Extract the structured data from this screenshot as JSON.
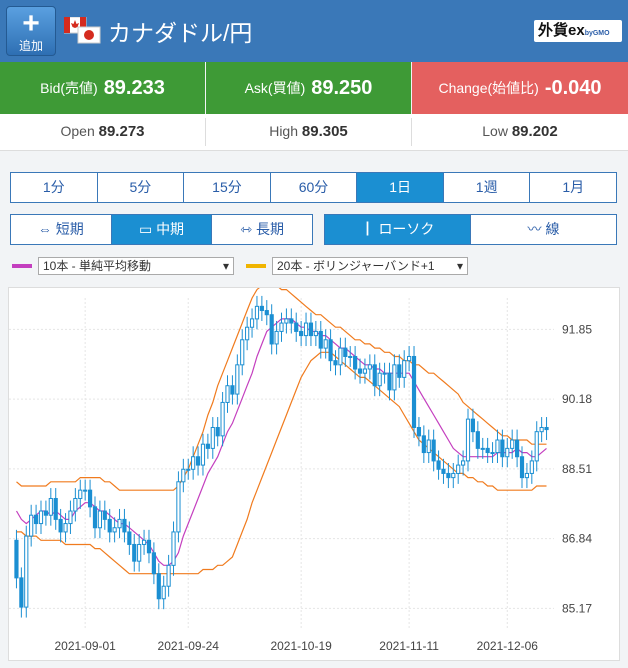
{
  "header": {
    "add_label": "追加",
    "pair_name": "カナダドル/円",
    "logo_text": "外貨ex",
    "logo_sub": "byGMO"
  },
  "quote": {
    "bid_label": "Bid(売値)",
    "bid_value": "89.233",
    "ask_label": "Ask(買値)",
    "ask_value": "89.250",
    "change_label": "Change(始値比)",
    "change_value": "-0.040"
  },
  "stats": {
    "open_label": "Open",
    "open_value": "89.273",
    "high_label": "High",
    "high_value": "89.305",
    "low_label": "Low",
    "low_value": "89.202"
  },
  "timeframes": [
    "1分",
    "5分",
    "15分",
    "60分",
    "1日",
    "1週",
    "1月"
  ],
  "timeframe_selected": "1日",
  "periods": [
    "短期",
    "中期",
    "長期"
  ],
  "period_selected": "中期",
  "chart_types": [
    "ローソク",
    "線"
  ],
  "chart_type_selected": "ローソク",
  "indicators": {
    "ma_label": "10本 - 単純平均移動",
    "bb_label": "20本 - ボリンジャーバンド+1"
  },
  "colors": {
    "header_bg": "#3a78b8",
    "bid_bg": "#3e9a36",
    "change_bg": "#e4605f",
    "candle_up": "#1b8fd2",
    "ma_line": "#c43fbf",
    "bb_line": "#f07b1e",
    "selected_bg": "#1b8fd2"
  },
  "chart_data": {
    "type": "candlestick",
    "y_ticks": [
      "91.85",
      "90.18",
      "88.51",
      "86.84",
      "85.17"
    ],
    "ylim": [
      84.7,
      92.6
    ],
    "x_ticks": [
      "2021-09-01",
      "2021-09-24",
      "2021-10-19",
      "2021-11-11",
      "2021-12-06"
    ],
    "close": [
      85.9,
      85.2,
      86.9,
      87.4,
      87.2,
      87.5,
      87.4,
      87.8,
      87.3,
      87.0,
      87.2,
      87.5,
      87.8,
      88.0,
      88.0,
      87.6,
      87.1,
      87.5,
      87.3,
      87.0,
      87.1,
      87.3,
      87.0,
      86.7,
      86.3,
      86.7,
      86.8,
      86.5,
      86.0,
      85.4,
      85.7,
      86.2,
      87.0,
      88.2,
      88.5,
      88.5,
      88.8,
      88.6,
      89.1,
      89.0,
      89.5,
      89.3,
      90.1,
      90.5,
      90.3,
      91.0,
      91.6,
      91.9,
      92.1,
      92.4,
      92.3,
      92.2,
      91.5,
      91.8,
      92.0,
      92.1,
      92.0,
      91.8,
      91.7,
      92.0,
      91.7,
      91.8,
      91.4,
      91.6,
      91.1,
      91.0,
      91.4,
      91.2,
      91.2,
      90.9,
      90.8,
      90.9,
      91.0,
      90.5,
      90.8,
      90.8,
      90.4,
      91.0,
      90.7,
      91.1,
      91.2,
      89.5,
      89.3,
      88.9,
      89.2,
      88.7,
      88.5,
      88.4,
      88.3,
      88.4,
      88.6,
      88.7,
      89.7,
      89.4,
      89.0,
      89.0,
      88.9,
      88.9,
      89.2,
      88.8,
      89.0,
      89.2,
      88.8,
      88.3,
      88.4,
      88.7,
      89.4,
      89.5,
      89.45
    ],
    "open": [
      86.8,
      85.9,
      85.2,
      86.9,
      87.4,
      87.2,
      87.5,
      87.4,
      87.8,
      87.3,
      87.0,
      87.2,
      87.5,
      87.8,
      88.0,
      88.0,
      87.6,
      87.1,
      87.5,
      87.3,
      87.0,
      87.1,
      87.3,
      87.0,
      86.7,
      86.3,
      86.7,
      86.8,
      86.5,
      86.0,
      85.4,
      85.7,
      86.2,
      87.0,
      88.2,
      88.5,
      88.5,
      88.8,
      88.6,
      89.1,
      89.0,
      89.5,
      89.3,
      90.1,
      90.5,
      90.3,
      91.0,
      91.6,
      91.9,
      92.1,
      92.4,
      92.3,
      92.2,
      91.5,
      91.8,
      92.0,
      92.1,
      92.0,
      91.8,
      91.7,
      92.0,
      91.7,
      91.8,
      91.4,
      91.6,
      91.1,
      91.0,
      91.4,
      91.2,
      91.2,
      90.9,
      90.8,
      90.9,
      91.0,
      90.5,
      90.8,
      90.8,
      90.4,
      91.0,
      90.7,
      91.1,
      91.2,
      89.5,
      89.3,
      88.9,
      89.2,
      88.7,
      88.5,
      88.4,
      88.3,
      88.4,
      88.6,
      88.7,
      89.7,
      89.4,
      89.0,
      89.0,
      88.9,
      88.9,
      89.2,
      88.8,
      89.0,
      89.2,
      88.8,
      88.3,
      88.4,
      88.7,
      89.4,
      89.5
    ],
    "ma10": [
      87.5,
      87.3,
      87.2,
      87.3,
      87.4,
      87.5,
      87.5,
      87.4,
      87.5,
      87.4,
      87.3,
      87.3,
      87.5,
      87.6,
      87.7,
      87.7,
      87.6,
      87.5,
      87.5,
      87.4,
      87.3,
      87.2,
      87.2,
      87.1,
      87.0,
      86.9,
      86.8,
      86.7,
      86.5,
      86.3,
      86.2,
      86.2,
      86.3,
      86.5,
      86.9,
      87.2,
      87.5,
      87.8,
      88.1,
      88.4,
      88.6,
      88.8,
      89.1,
      89.4,
      89.6,
      89.9,
      90.2,
      90.5,
      90.8,
      91.2,
      91.5,
      91.8,
      91.9,
      92.0,
      92.1,
      92.1,
      92.1,
      92.0,
      91.9,
      91.9,
      91.8,
      91.8,
      91.7,
      91.7,
      91.6,
      91.5,
      91.4,
      91.4,
      91.3,
      91.2,
      91.1,
      91.0,
      91.0,
      90.9,
      90.9,
      90.8,
      90.8,
      90.8,
      90.8,
      90.8,
      90.8,
      90.6,
      90.4,
      90.2,
      90.0,
      89.8,
      89.6,
      89.4,
      89.2,
      89.0,
      88.9,
      88.8,
      88.8,
      88.8,
      88.8,
      88.8,
      88.8,
      88.8,
      88.9,
      88.9,
      88.9,
      88.9,
      89.0,
      88.9,
      88.9,
      88.8,
      88.8,
      88.9,
      89.0
    ],
    "bb_upper": [
      88.2,
      88.1,
      88.1,
      88.1,
      88.1,
      88.1,
      88.1,
      88.2,
      88.2,
      88.2,
      88.2,
      88.2,
      88.2,
      88.3,
      88.3,
      88.3,
      88.3,
      88.3,
      88.2,
      88.2,
      88.1,
      88.0,
      88.0,
      88.0,
      88.0,
      88.0,
      88.0,
      88.0,
      88.0,
      88.0,
      88.0,
      88.0,
      88.0,
      88.1,
      88.3,
      88.5,
      88.8,
      89.1,
      89.4,
      89.8,
      90.1,
      90.5,
      90.8,
      91.1,
      91.4,
      91.7,
      92.0,
      92.3,
      92.6,
      92.8,
      92.9,
      93.0,
      93.0,
      92.9,
      92.8,
      92.8,
      92.7,
      92.6,
      92.5,
      92.4,
      92.3,
      92.2,
      92.2,
      92.1,
      92.0,
      91.9,
      91.9,
      91.8,
      91.7,
      91.6,
      91.6,
      91.5,
      91.5,
      91.4,
      91.4,
      91.3,
      91.3,
      91.2,
      91.2,
      91.1,
      91.1,
      91.0,
      91.0,
      90.9,
      90.8,
      90.8,
      90.7,
      90.6,
      90.5,
      90.4,
      90.3,
      90.1,
      90.0,
      89.9,
      89.8,
      89.7,
      89.6,
      89.5,
      89.4,
      89.3,
      89.3,
      89.2,
      89.2,
      89.2,
      89.2,
      89.1,
      89.1,
      89.1,
      89.1
    ],
    "bb_lower": [
      87.0,
      87.0,
      86.9,
      86.9,
      86.9,
      86.8,
      86.8,
      86.8,
      86.8,
      86.8,
      86.7,
      86.7,
      86.7,
      86.7,
      86.7,
      86.7,
      86.6,
      86.6,
      86.5,
      86.4,
      86.3,
      86.2,
      86.1,
      86.0,
      86.0,
      86.0,
      86.0,
      86.0,
      86.0,
      86.0,
      86.0,
      86.0,
      86.0,
      86.0,
      86.0,
      86.0,
      86.0,
      86.0,
      86.1,
      86.1,
      86.1,
      86.2,
      86.2,
      86.3,
      86.4,
      86.7,
      87.0,
      87.3,
      87.7,
      88.0,
      88.3,
      88.6,
      88.9,
      89.2,
      89.5,
      89.8,
      90.1,
      90.4,
      90.7,
      90.9,
      91.1,
      91.2,
      91.3,
      91.3,
      91.3,
      91.2,
      91.1,
      91.0,
      90.9,
      90.8,
      90.7,
      90.7,
      90.6,
      90.5,
      90.4,
      90.3,
      90.2,
      90.1,
      90.0,
      89.8,
      89.6,
      89.4,
      89.2,
      89.1,
      89.0,
      88.9,
      88.8,
      88.7,
      88.6,
      88.5,
      88.4,
      88.4,
      88.3,
      88.3,
      88.2,
      88.2,
      88.1,
      88.1,
      88.0,
      88.0,
      88.0,
      88.0,
      88.0,
      88.0,
      88.0,
      88.0,
      88.1,
      88.1,
      88.1
    ]
  }
}
